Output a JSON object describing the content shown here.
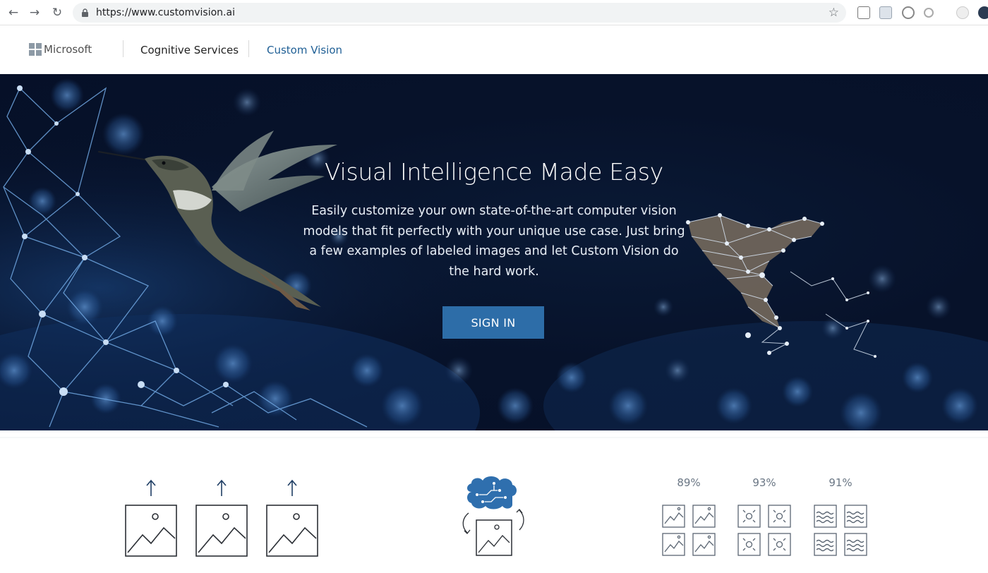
{
  "browser": {
    "url": "https://www.customvision.ai",
    "back_icon": "arrow-left-icon",
    "forward_icon": "arrow-right-icon",
    "reload_icon": "reload-icon",
    "bookmark_icon": "star-icon"
  },
  "header": {
    "brand": "Microsoft",
    "nav": [
      "Cognitive Services",
      "Custom Vision"
    ],
    "accent_color": "#1f5f95"
  },
  "hero": {
    "title": "Visual Intelligence Made Easy",
    "description": "Easily customize your own state-of-the-art computer vision models that fit perfectly with your unique use case. Just bring a few examples of labeled images and let Custom Vision do the hard work.",
    "cta": "SIGN IN",
    "cta_color": "#2d6da8"
  },
  "steps": {
    "upload_icons": [
      "upload-arrow-icon",
      "upload-arrow-icon",
      "upload-arrow-icon"
    ],
    "train_icon": "brain-circuit-icon",
    "accuracy_labels": [
      "89%",
      "93%",
      "91%"
    ]
  }
}
